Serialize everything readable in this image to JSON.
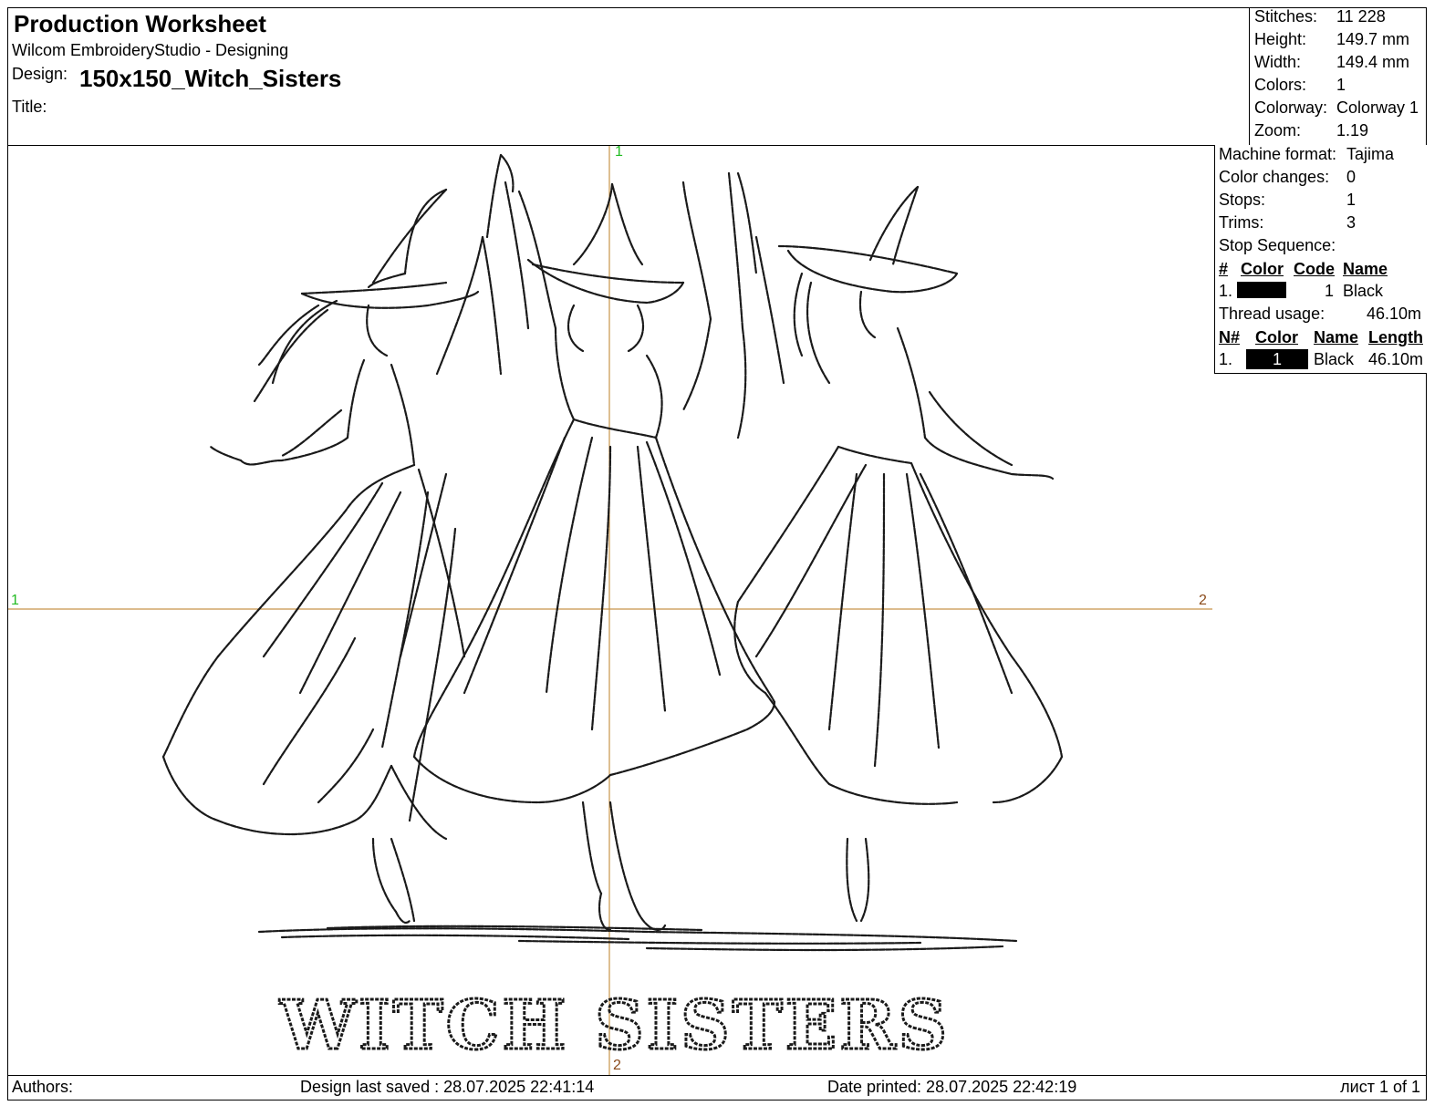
{
  "header": {
    "title": "Production Worksheet",
    "subtitle": "Wilcom EmbroideryStudio - Designing",
    "design_label": "Design:",
    "design_value": "150x150_Witch_Sisters",
    "title_label": "Title:"
  },
  "stats": {
    "stitches_label": "Stitches:",
    "stitches_value": "11 228",
    "height_label": "Height:",
    "height_value": "149.7 mm",
    "width_label": "Width:",
    "width_value": "149.4 mm",
    "colors_label": "Colors:",
    "colors_value": "1",
    "colorway_label": "Colorway:",
    "colorway_value": "Colorway 1",
    "zoom_label": "Zoom:",
    "zoom_value": "1.19"
  },
  "machine": {
    "format_label": "Machine format:",
    "format_value": "Tajima",
    "color_changes_label": "Color changes:",
    "color_changes_value": "0",
    "stops_label": "Stops:",
    "stops_value": "1",
    "trims_label": "Trims:",
    "trims_value": "3",
    "stop_sequence_label": "Stop Sequence:",
    "stop_headers": [
      "#",
      "Color",
      "Code",
      "Name"
    ],
    "stop_rows": [
      {
        "num": "1.",
        "code": "1",
        "name": "Black",
        "color": "#000000"
      }
    ],
    "thread_usage_label": "Thread usage:",
    "thread_usage_value": "46.10m",
    "thread_headers": [
      "N#",
      "Color",
      "Name",
      "Length"
    ],
    "thread_rows": [
      {
        "num": "1.",
        "swatch_label": "1",
        "name": "Black",
        "length": "46.10m",
        "color": "#000000"
      }
    ]
  },
  "axes": {
    "top_marker": "1",
    "bottom_marker": "2",
    "left_marker": "1",
    "right_marker": "2",
    "axis_color": "#c8954a"
  },
  "design": {
    "caption": "WITCH SISTERS",
    "thread_color": "#1a1a1a"
  },
  "footer": {
    "authors": "Authors:",
    "last_saved": "Design last saved : 28.07.2025 22:41:14",
    "printed": "Date printed: 28.07.2025 22:42:19",
    "page": "лист 1 of 1"
  }
}
